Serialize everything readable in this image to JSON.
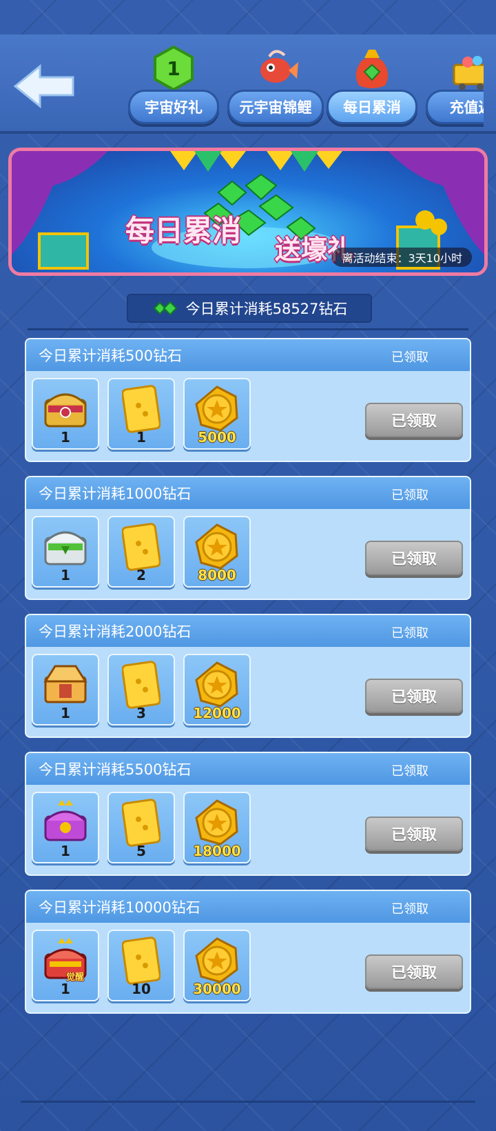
{
  "tabs": [
    {
      "label": "宇宙好礼",
      "icon": "green-hexagon-badge-icon"
    },
    {
      "label": "元宇宙锦鲤",
      "icon": "koi-fish-icon"
    },
    {
      "label": "每日累消",
      "icon": "money-bag-gem-icon"
    },
    {
      "label": "充值返",
      "icon": "shopping-cart-icon"
    }
  ],
  "banner": {
    "title": "每日累消",
    "subtitle": "送壕礼",
    "countdown": "离活动结束：3天10小时"
  },
  "summary": {
    "text": "今日累计消耗58527钻石"
  },
  "tiers": [
    {
      "title": "今日累计消耗500钻石",
      "status": "已领取",
      "button": "已领取",
      "rewards": [
        {
          "icon": "gold-red-chest-icon",
          "qty": "1"
        },
        {
          "icon": "dice-card-icon",
          "qty": "1"
        },
        {
          "icon": "gold-coin-icon",
          "qty": "5000"
        }
      ]
    },
    {
      "title": "今日累计消耗1000钻石",
      "status": "已领取",
      "button": "已领取",
      "rewards": [
        {
          "icon": "silver-green-chest-icon",
          "qty": "1"
        },
        {
          "icon": "dice-card-icon",
          "qty": "2"
        },
        {
          "icon": "gold-coin-icon",
          "qty": "8000"
        }
      ]
    },
    {
      "title": "今日累计消耗2000钻石",
      "status": "已领取",
      "button": "已领取",
      "rewards": [
        {
          "icon": "golden-chest-icon",
          "qty": "1"
        },
        {
          "icon": "dice-card-icon",
          "qty": "3"
        },
        {
          "icon": "gold-coin-icon",
          "qty": "12000"
        }
      ]
    },
    {
      "title": "今日累计消耗5500钻石",
      "status": "已领取",
      "button": "已领取",
      "rewards": [
        {
          "icon": "purple-crown-chest-icon",
          "qty": "1"
        },
        {
          "icon": "dice-card-icon",
          "qty": "5"
        },
        {
          "icon": "gold-coin-icon",
          "qty": "18000"
        }
      ]
    },
    {
      "title": "今日累计消耗10000钻石",
      "status": "已领取",
      "button": "已领取",
      "rewards": [
        {
          "icon": "red-crown-chest-icon",
          "qty": "1",
          "badge": "觉醒"
        },
        {
          "icon": "dice-card-icon",
          "qty": "10"
        },
        {
          "icon": "gold-coin-icon",
          "qty": "30000"
        }
      ]
    }
  ],
  "colors": {
    "accent": "#4f97e3",
    "card": "#b9ddfa",
    "button_disabled": "#a8a8a8",
    "coin": "#f4b400"
  }
}
